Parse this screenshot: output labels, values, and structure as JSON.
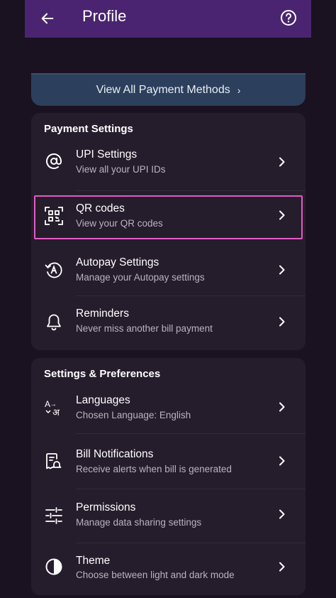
{
  "header": {
    "title": "Profile"
  },
  "payment_methods_button": {
    "label": "View All Payment Methods",
    "chevron": "›"
  },
  "payment_settings": {
    "heading": "Payment Settings",
    "items": [
      {
        "icon": "at-icon",
        "title": "UPI Settings",
        "subtitle": "View all your UPI IDs"
      },
      {
        "icon": "qr-code-icon",
        "title": "QR codes",
        "subtitle": "View your QR codes"
      },
      {
        "icon": "autopay-icon",
        "title": "Autopay Settings",
        "subtitle": "Manage your Autopay settings"
      },
      {
        "icon": "bell-icon",
        "title": "Reminders",
        "subtitle": "Never miss another bill payment"
      }
    ]
  },
  "settings_preferences": {
    "heading": "Settings & Preferences",
    "items": [
      {
        "icon": "language-icon",
        "title": "Languages",
        "subtitle": "Chosen Language: English"
      },
      {
        "icon": "bill-notification-icon",
        "title": "Bill Notifications",
        "subtitle": "Receive alerts when bill is generated"
      },
      {
        "icon": "permissions-sliders-icon",
        "title": "Permissions",
        "subtitle": "Manage data sharing settings"
      },
      {
        "icon": "theme-icon",
        "title": "Theme",
        "subtitle": "Choose between light and dark mode"
      }
    ]
  },
  "colors": {
    "header": "#4a2470",
    "background": "#1a1220",
    "card": "#251d2c",
    "highlight": "#e35bc4",
    "pay_button": "#2c3f5c"
  }
}
